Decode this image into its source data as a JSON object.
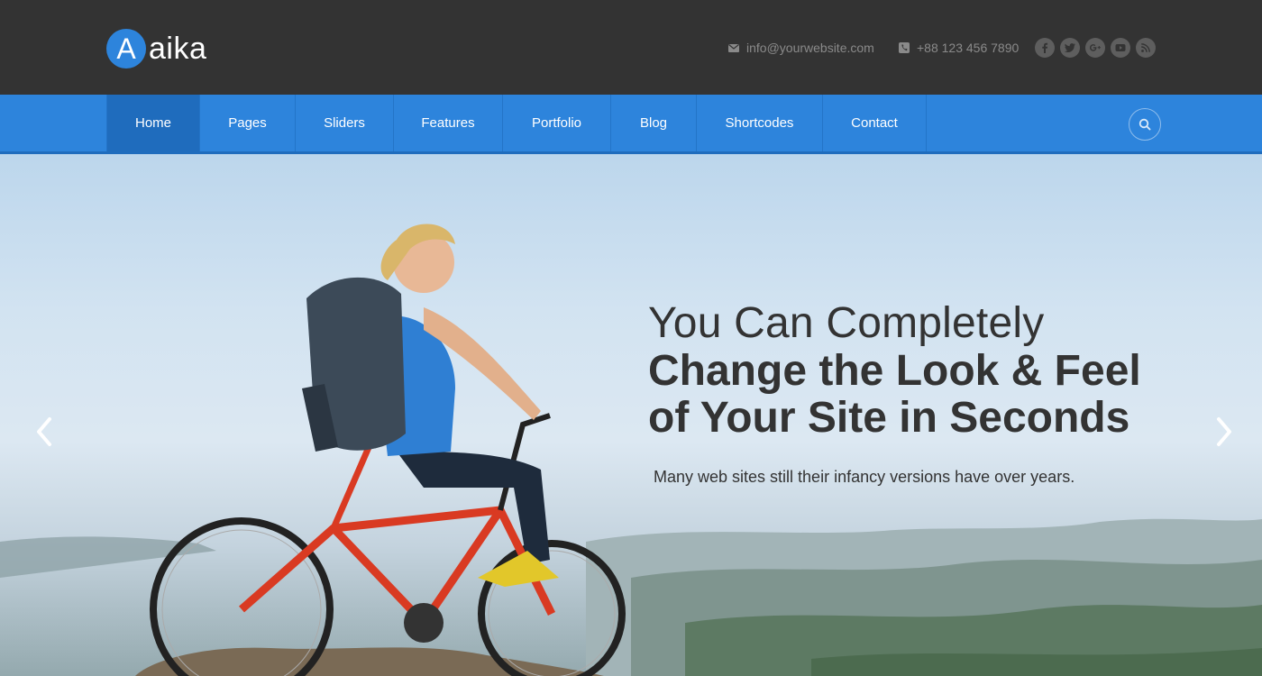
{
  "brand": {
    "logo_letter": "A",
    "logo_name": "aika"
  },
  "header": {
    "email": "info@yourwebsite.com",
    "phone": "+88 123 456 7890",
    "socials": [
      "facebook-icon",
      "twitter-icon",
      "google-plus-icon",
      "youtube-icon",
      "rss-icon"
    ]
  },
  "nav": {
    "items": [
      {
        "label": "Home",
        "active": true
      },
      {
        "label": "Pages"
      },
      {
        "label": "Sliders"
      },
      {
        "label": "Features"
      },
      {
        "label": "Portfolio"
      },
      {
        "label": "Blog"
      },
      {
        "label": "Shortcodes"
      },
      {
        "label": "Contact"
      }
    ],
    "search_icon": "search-icon"
  },
  "hero": {
    "title_line1": "You Can Completely",
    "title_line2": "Change the Look & Feel",
    "title_line3": "of Your Site in Seconds",
    "subtitle": "Many web sites still their infancy versions have over years.",
    "prev_icon": "chevron-left-icon",
    "next_icon": "chevron-right-icon"
  },
  "colors": {
    "topbar": "#333333",
    "accent": "#2d84dc",
    "nav_active": "#1f6cbd",
    "text_dark": "#333333"
  }
}
